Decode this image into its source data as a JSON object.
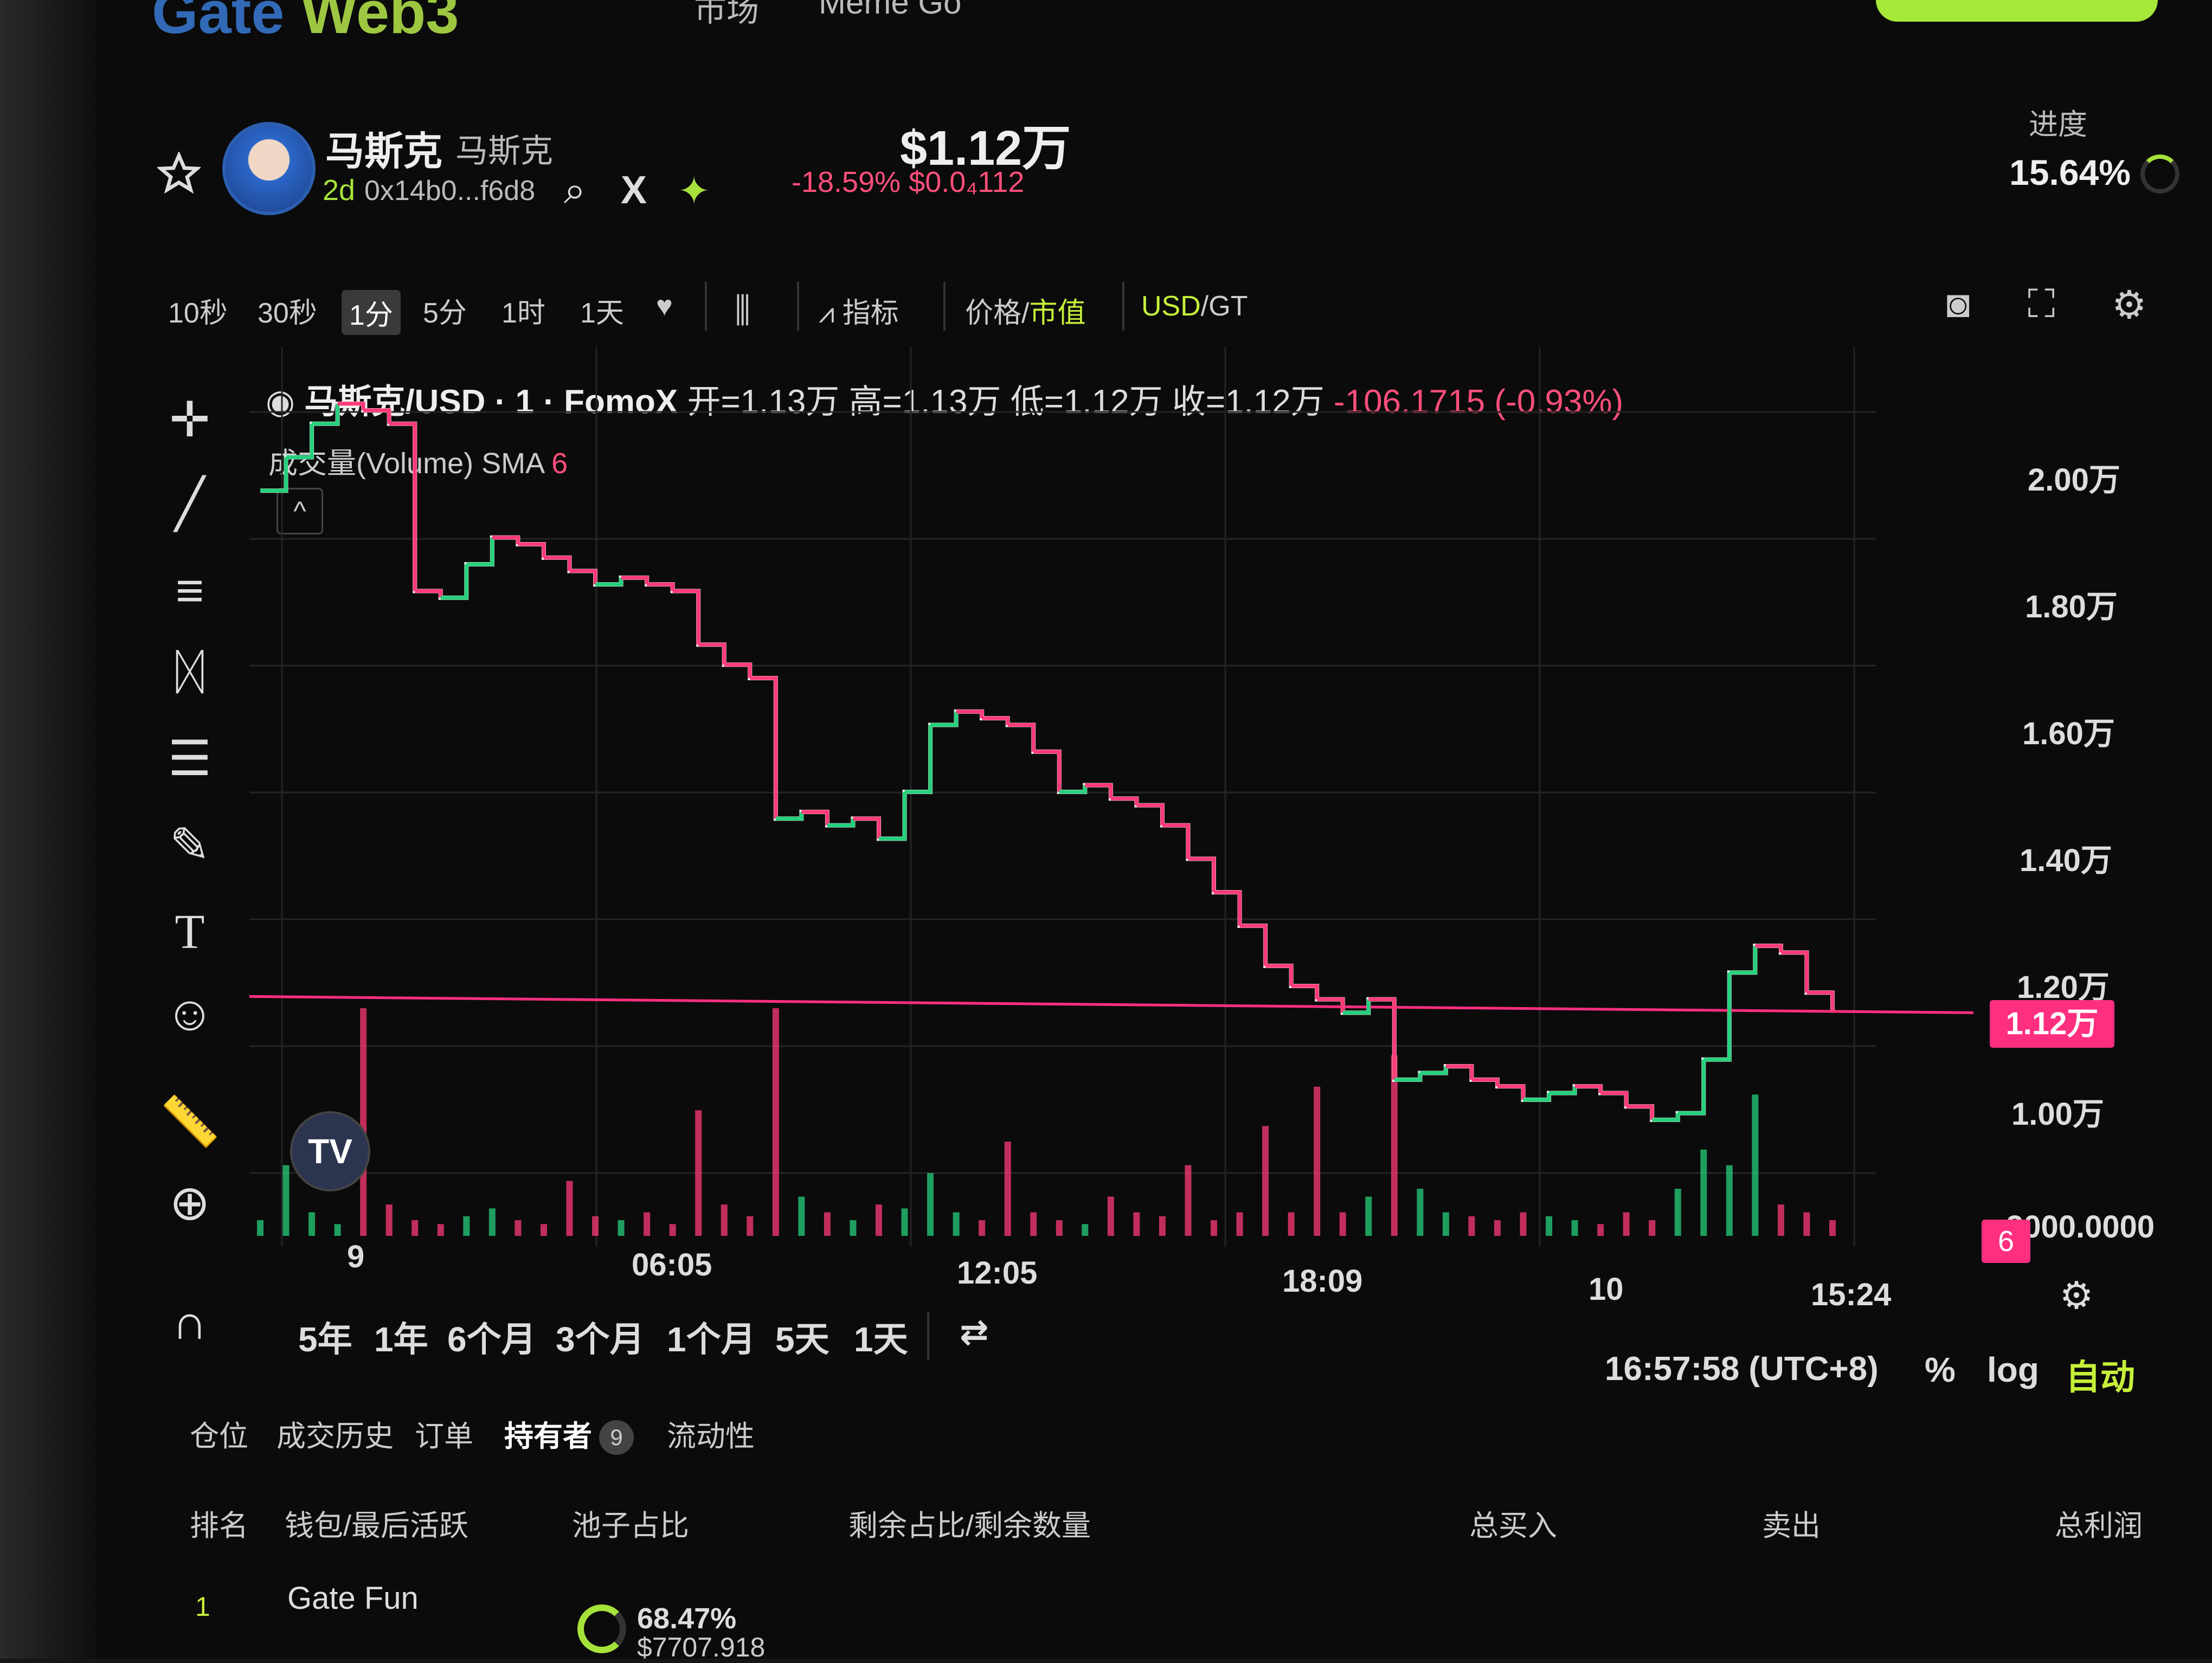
{
  "brand": {
    "name_a": "Gate",
    "name_b": "Web3"
  },
  "nav": {
    "item1": "市场",
    "item2": "Meme Go"
  },
  "token": {
    "name": "马斯克",
    "subname": "马斯克",
    "age": "2d",
    "address": "0x14b0...f6d8",
    "price": "$1.12万",
    "change_pct": "-18.59%",
    "price_small": "$0.0₄112"
  },
  "progress": {
    "label": "进度",
    "value": "15.64%",
    "fraction": 0.1564
  },
  "toolbar": {
    "intervals": [
      "10秒",
      "30秒",
      "1分",
      "5分",
      "1时",
      "1天"
    ],
    "active_interval": "1分",
    "indicators": "指标",
    "price_label": "价格",
    "mcap_label": "市值",
    "usd_label": "USD",
    "gt_label": "GT"
  },
  "legend": {
    "pair": "马斯克/USD · 1 · FomoX",
    "open": "开=1.13万",
    "high": "高=1.13万",
    "low": "低=1.12万",
    "close": "收=1.12万",
    "change": "-106.1715 (-0.93%)",
    "volume": "成交量(Volume) SMA",
    "sma_len": "6"
  },
  "colors": {
    "up": "#26d07c",
    "down": "#ff3b78",
    "accent": "#c6f03a",
    "price_line": "#ff2f80"
  },
  "y_axis": [
    "2.00万",
    "1.80万",
    "1.60万",
    "1.40万",
    "1.20万",
    "1.00万"
  ],
  "price_tag": "1.12万",
  "vol_axis": "2000.0000",
  "vol_tag": "6",
  "x_axis": [
    "9",
    "06:05",
    "12:05",
    "18:09",
    "10",
    "15:24"
  ],
  "ranges": [
    "5年",
    "1年",
    "6个月",
    "3个月",
    "1个月",
    "5天",
    "1天"
  ],
  "time_readout": "16:57:58 (UTC+8)",
  "scale": {
    "pct": "%",
    "log": "log",
    "auto": "自动"
  },
  "tabs": {
    "items": [
      "仓位",
      "成交历史",
      "订单",
      "持有者",
      "流动性"
    ],
    "active": "持有者",
    "badge": "9"
  },
  "table": {
    "headers": [
      "排名",
      "钱包/最后活跃",
      "池子占比",
      "剩余占比/剩余数量",
      "总买入",
      "卖出",
      "总利润"
    ],
    "rows": [
      {
        "rank": "1",
        "wallet": "Gate Fun",
        "share": "68.47%",
        "value": "$7707.918"
      }
    ]
  },
  "chart_data": {
    "type": "line",
    "title": "",
    "ylabel": "",
    "ylim": [
      9000,
      20500
    ],
    "x_labels": [
      "9",
      "06:05",
      "12:05",
      "18:09",
      "10",
      "15:24"
    ],
    "series": [
      {
        "values": [
          19000,
          19500,
          20000,
          20300,
          20200,
          20000,
          17500,
          17400,
          17900,
          18300,
          18200,
          18000,
          17800,
          17600,
          17700,
          17600,
          17500,
          16700,
          16400,
          16200,
          14100,
          14200,
          14000,
          14100,
          13800,
          14500,
          15500,
          15700,
          15600,
          15500,
          15100,
          14500,
          14600,
          14400,
          14300,
          14000,
          13500,
          13000,
          12500,
          11900,
          11600,
          11400,
          11200,
          11400,
          10200,
          10300,
          10400,
          10200,
          10100,
          9900,
          10000,
          10100,
          10000,
          9800,
          9600,
          9700,
          10500,
          11800,
          12200,
          12100,
          11500,
          11200
        ],
        "volume": [
          200,
          900,
          300,
          150,
          2900,
          400,
          200,
          150,
          250,
          350,
          200,
          150,
          700,
          250,
          200,
          300,
          150,
          1600,
          400,
          250,
          2900,
          500,
          300,
          200,
          400,
          350,
          800,
          300,
          200,
          1200,
          300,
          200,
          150,
          500,
          300,
          250,
          900,
          200,
          300,
          1400,
          300,
          1900,
          300,
          500,
          2300,
          600,
          300,
          250,
          200,
          300,
          250,
          200,
          150,
          300,
          200,
          600,
          1100,
          900,
          1800,
          400,
          300,
          200
        ]
      }
    ],
    "last_price": 11200
  }
}
